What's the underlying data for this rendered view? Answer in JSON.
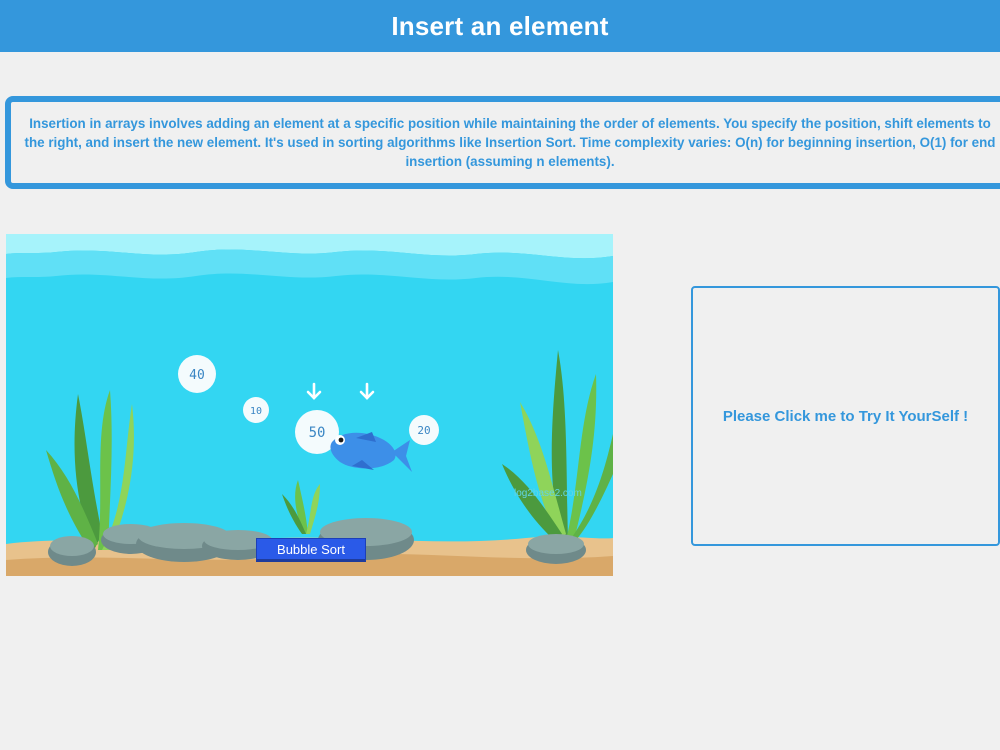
{
  "header": {
    "title": "Insert an element"
  },
  "description": {
    "text": "Insertion in arrays involves adding an element at a specific position while maintaining the order of elements. You specify the position, shift elements to the right, and insert the new element. It's used in sorting algorithms like Insertion Sort. Time complexity varies: O(n) for beginning insertion, O(1) for end insertion (assuming n elements)."
  },
  "animation": {
    "bubbles": [
      {
        "label": "40"
      },
      {
        "label": "10"
      },
      {
        "label": "50"
      },
      {
        "label": "20"
      }
    ],
    "watermark": "log2base2.com",
    "button_label": "Bubble Sort"
  },
  "try_panel": {
    "label": "Please Click me to Try It YourSelf !"
  },
  "colors": {
    "accent": "#3497dc",
    "button": "#2a5ae8",
    "water": "#33d6f2",
    "sand": "#e8c28c"
  }
}
